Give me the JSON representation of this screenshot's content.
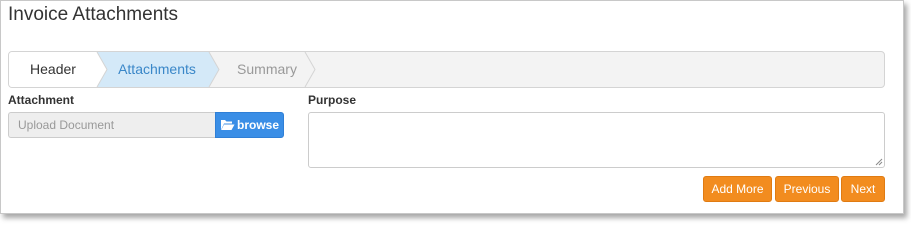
{
  "page": {
    "title": "Invoice Attachments"
  },
  "wizard": {
    "steps": [
      {
        "label": "Header",
        "state": "completed"
      },
      {
        "label": "Attachments",
        "state": "active"
      },
      {
        "label": "Summary",
        "state": "upcoming"
      }
    ]
  },
  "form": {
    "attachment_label": "Attachment",
    "upload_placeholder": "Upload Document",
    "browse_label": "browse",
    "purpose_label": "Purpose",
    "purpose_value": ""
  },
  "actions": {
    "add_more": "Add More",
    "previous": "Previous",
    "next": "Next"
  },
  "icons": {
    "browse": "folder-open-icon",
    "textarea_resize": "resize-grip-icon"
  },
  "colors": {
    "accent_orange": "#f28c1f",
    "browse_blue": "#3a8ee6",
    "active_step_fill": "#d4e9f8",
    "active_step_text": "#3a87c8"
  }
}
